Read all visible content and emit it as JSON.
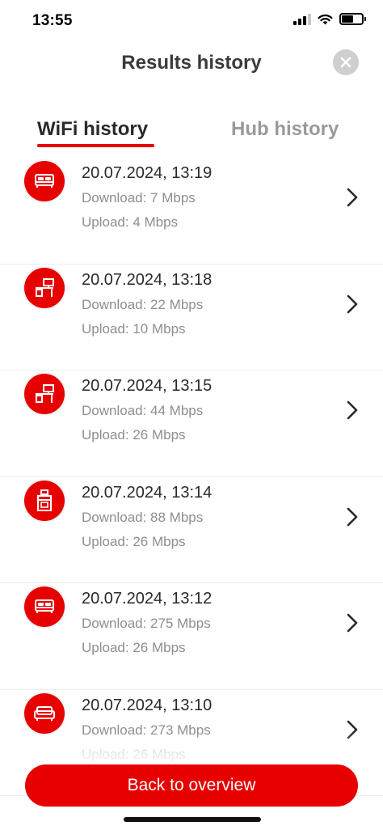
{
  "status_bar": {
    "time": "13:55",
    "signal_icon": "cellular-signal-icon",
    "wifi_icon": "wifi-icon",
    "battery_icon": "battery-icon",
    "battery_level": 0.6
  },
  "header": {
    "title": "Results history",
    "close_icon": "close-icon"
  },
  "tabs": [
    {
      "label": "WiFi history",
      "active": true
    },
    {
      "label": "Hub history",
      "active": false
    }
  ],
  "accent_color": "#e60000",
  "results": [
    {
      "date": "20.07.2024, 13:19",
      "download": "Download: 7 Mbps",
      "upload": "Upload: 4 Mbps",
      "icon": "bed-icon"
    },
    {
      "date": "20.07.2024, 13:18",
      "download": "Download: 22 Mbps",
      "upload": "Upload: 10 Mbps",
      "icon": "desk-icon"
    },
    {
      "date": "20.07.2024, 13:15",
      "download": "Download: 44 Mbps",
      "upload": "Upload: 26 Mbps",
      "icon": "desk-icon"
    },
    {
      "date": "20.07.2024, 13:14",
      "download": "Download: 88 Mbps",
      "upload": "Upload: 26 Mbps",
      "icon": "oven-icon"
    },
    {
      "date": "20.07.2024, 13:12",
      "download": "Download: 275 Mbps",
      "upload": "Upload: 26 Mbps",
      "icon": "bed-icon"
    },
    {
      "date": "20.07.2024, 13:10",
      "download": "Download: 273 Mbps",
      "upload": "Upload: 26 Mbps",
      "icon": "sofa-icon"
    }
  ],
  "footer": {
    "back_label": "Back to overview"
  }
}
